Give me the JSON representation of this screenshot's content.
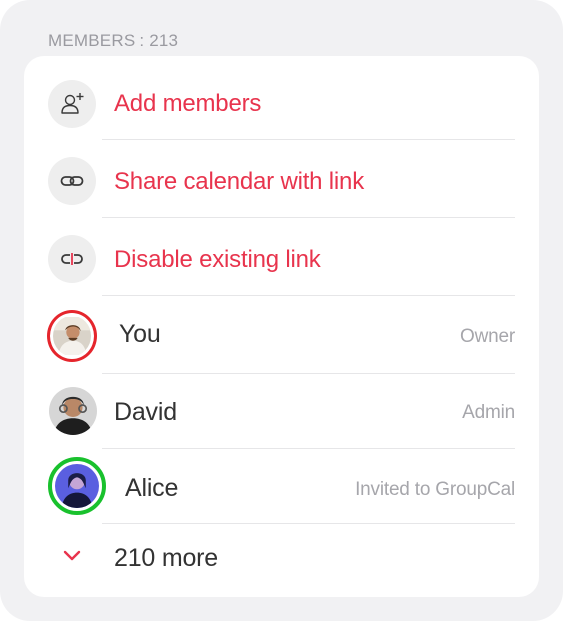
{
  "header": {
    "members_label": "MEMBERS",
    "members_count": ": 213"
  },
  "actions": [
    {
      "label": "Add members",
      "icon": "add-person-icon"
    },
    {
      "label": "Share calendar with link",
      "icon": "link-icon"
    },
    {
      "label": "Disable existing link",
      "icon": "broken-link-icon"
    }
  ],
  "members": [
    {
      "name": "You",
      "role": "Owner",
      "ring": "red"
    },
    {
      "name": "David",
      "role": "Admin",
      "ring": "none"
    },
    {
      "name": "Alice",
      "role": "Invited to GroupCal",
      "ring": "green"
    }
  ],
  "more": {
    "label": "210 more",
    "icon": "chevron-down-icon"
  },
  "colors": {
    "accent": "#e8344d",
    "ring_red": "#e5252c",
    "ring_green": "#19c12d",
    "panel_bg": "#f1f1f3"
  }
}
